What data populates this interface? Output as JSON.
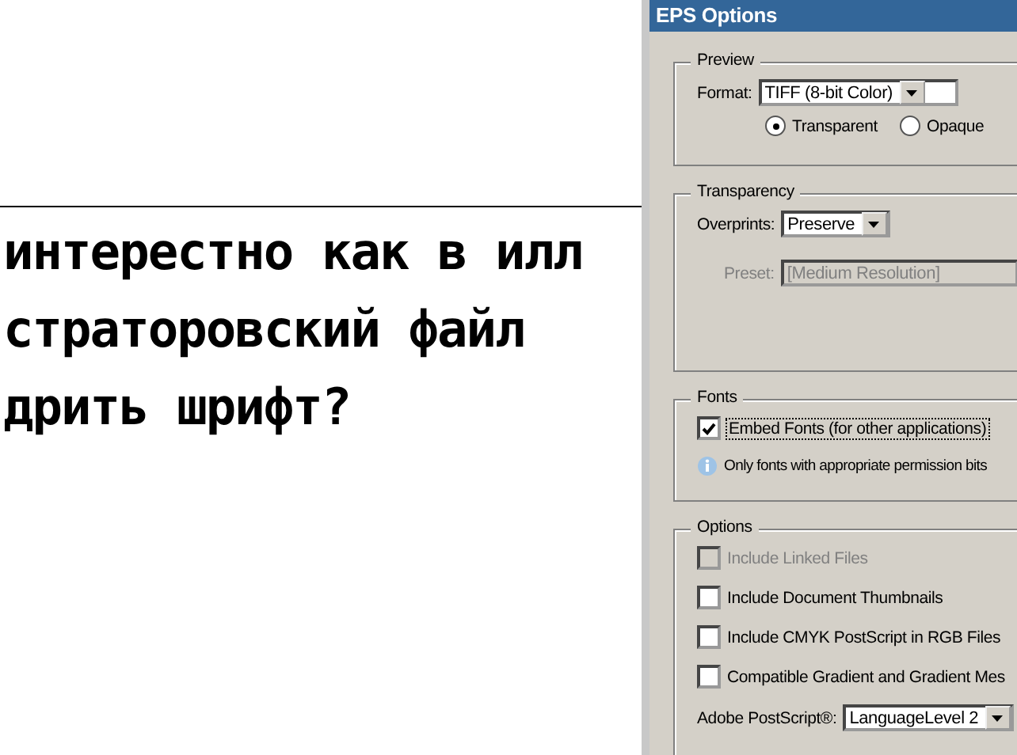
{
  "canvas": {
    "lines": [
      "интерестно как в илл",
      "страторовский файл",
      "дрить шрифт?"
    ]
  },
  "window": {
    "title": "EPS Options"
  },
  "preview": {
    "label": "Preview",
    "format": {
      "label": "Format:",
      "value": "TIFF (8-bit Color)"
    },
    "radios": [
      {
        "label": "Transparent",
        "selected": true
      },
      {
        "label": "Opaque",
        "selected": false
      }
    ]
  },
  "transparency": {
    "label": "Transparency",
    "overprints": {
      "label": "Overprints:",
      "value": "Preserve"
    },
    "preset": {
      "label": "Preset:",
      "value": "[Medium Resolution]",
      "disabled": true
    }
  },
  "fonts": {
    "label": "Fonts",
    "embed": {
      "label": "Embed Fonts (for other applications)",
      "checked": true
    },
    "note": "Only fonts with appropriate permission bits"
  },
  "options": {
    "label": "Options",
    "checkboxes": [
      {
        "label": "Include Linked Files",
        "checked": false,
        "disabled": true
      },
      {
        "label": "Include Document Thumbnails",
        "checked": false,
        "disabled": false
      },
      {
        "label": "Include CMYK PostScript in RGB Files",
        "checked": false,
        "disabled": false
      },
      {
        "label": "Compatible Gradient and Gradient Mes",
        "checked": false,
        "disabled": false
      }
    ],
    "postscript": {
      "label": "Adobe PostScript®:",
      "value": "LanguageLevel 2"
    }
  }
}
